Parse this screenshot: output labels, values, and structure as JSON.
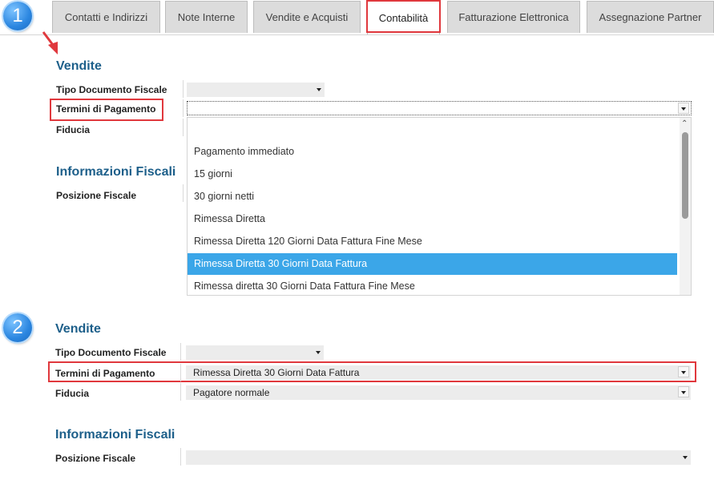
{
  "tabs": [
    {
      "label": "Contatti e Indirizzi"
    },
    {
      "label": "Note Interne"
    },
    {
      "label": "Vendite e Acquisti"
    },
    {
      "label": "Contabilità"
    },
    {
      "label": "Fatturazione Elettronica"
    },
    {
      "label": "Assegnazione Partner"
    }
  ],
  "steps": [
    "1",
    "2"
  ],
  "panel1": {
    "section_vendite": "Vendite",
    "tipo_documento_label": "Tipo Documento Fiscale",
    "termini_label": "Termini di Pagamento",
    "fiducia_label": "Fiducia",
    "section_fiscali": "Informazioni Fiscali",
    "posizione_label": "Posizione Fiscale",
    "dropdown_options": [
      "Pagamento immediato",
      "15 giorni",
      "30 giorni netti",
      "Rimessa Diretta",
      "Rimessa Diretta 120 Giorni Data Fattura Fine Mese",
      "Rimessa Diretta 30 Giorni Data Fattura",
      "Rimessa diretta 30 Giorni Data Fattura Fine Mese"
    ],
    "selected_option": "Rimessa Diretta 30 Giorni Data Fattura"
  },
  "panel2": {
    "section_vendite": "Vendite",
    "tipo_documento_label": "Tipo Documento Fiscale",
    "termini_label": "Termini di Pagamento",
    "termini_value": "Rimessa Diretta 30 Giorni Data Fattura",
    "fiducia_label": "Fiducia",
    "fiducia_value": "Pagatore normale",
    "section_fiscali": "Informazioni Fiscali",
    "posizione_label": "Posizione Fiscale"
  },
  "colors": {
    "accent_highlight": "#e0383d",
    "selected_option_bg": "#3ba6e8",
    "section_title": "#1d5f8a",
    "badge": "#2b86e0"
  }
}
